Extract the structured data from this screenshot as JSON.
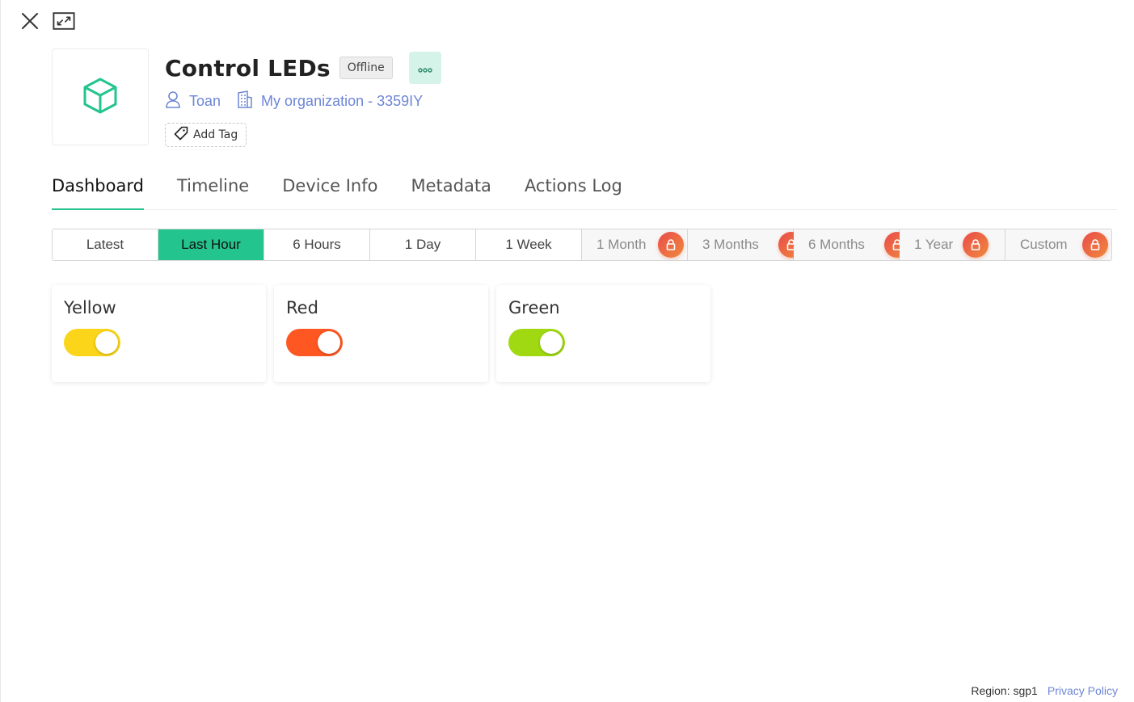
{
  "window": {
    "close_icon": "close-icon",
    "expand_icon": "expand-icon"
  },
  "device": {
    "title": "Control LEDs",
    "status": "Offline",
    "more_icon": "more-dots-icon",
    "owner": "Toan",
    "organization": "My organization - 3359IY",
    "add_tag_label": "Add Tag",
    "tile_icon": "cube-icon"
  },
  "tabs": [
    {
      "label": "Dashboard",
      "active": true
    },
    {
      "label": "Timeline",
      "active": false
    },
    {
      "label": "Device Info",
      "active": false
    },
    {
      "label": "Metadata",
      "active": false
    },
    {
      "label": "Actions Log",
      "active": false
    }
  ],
  "ranges": [
    {
      "label": "Latest",
      "active": false,
      "locked": false
    },
    {
      "label": "Last Hour",
      "active": true,
      "locked": false
    },
    {
      "label": "6 Hours",
      "active": false,
      "locked": false
    },
    {
      "label": "1 Day",
      "active": false,
      "locked": false
    },
    {
      "label": "1 Week",
      "active": false,
      "locked": false
    },
    {
      "label": "1 Month",
      "active": false,
      "locked": true
    },
    {
      "label": "3 Months",
      "active": false,
      "locked": true
    },
    {
      "label": "6 Months",
      "active": false,
      "locked": true
    },
    {
      "label": "1 Year",
      "active": false,
      "locked": true
    },
    {
      "label": "Custom",
      "active": false,
      "locked": true
    }
  ],
  "widgets": [
    {
      "label": "Yellow",
      "state": "on",
      "color": "#fad519"
    },
    {
      "label": "Red",
      "state": "on",
      "color": "#ff5722"
    },
    {
      "label": "Green",
      "state": "on",
      "color": "#a0d911"
    }
  ],
  "colors": {
    "accent": "#23c48e",
    "link": "#6d86d6"
  },
  "footer": {
    "region": "Region: sgp1",
    "privacy": "Privacy Policy"
  }
}
